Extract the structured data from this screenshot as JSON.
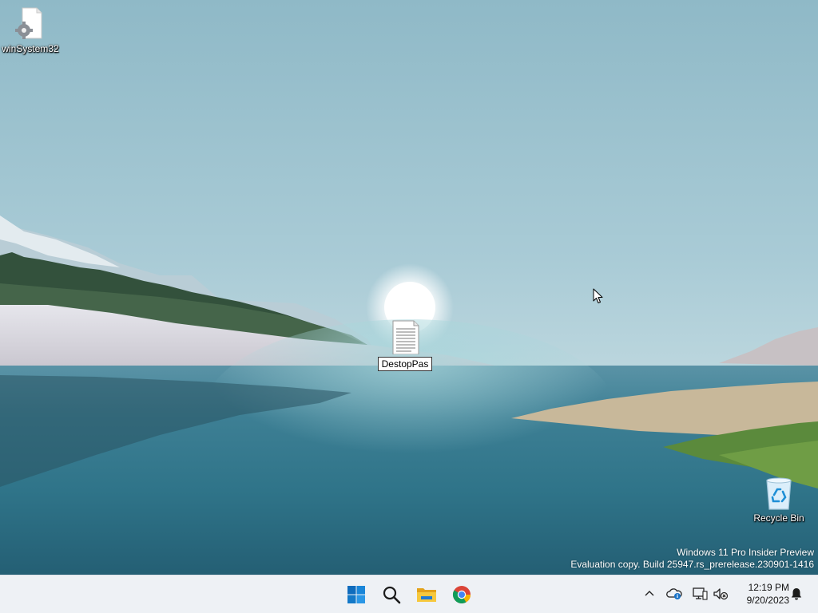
{
  "desktop": {
    "icons": [
      {
        "label": "winSystem32",
        "icon": "settings-file-icon"
      },
      {
        "label": "DestopPas",
        "icon": "text-document-icon"
      },
      {
        "label": "Recycle Bin",
        "icon": "recycle-bin-icon"
      }
    ]
  },
  "watermark": {
    "line1": "Windows 11 Pro Insider Preview",
    "line2": "Evaluation copy. Build 25947.rs_prerelease.230901-1416"
  },
  "taskbar": {
    "apps": [
      "start-icon",
      "search-icon",
      "file-explorer-icon",
      "chrome-icon"
    ],
    "tray": [
      "chevron-up-icon",
      "onedrive-icon",
      "network-icon",
      "volume-muted-icon",
      "notification-bell-icon"
    ],
    "time": "12:19 PM",
    "date": "9/20/2023"
  },
  "colors": {
    "taskbar_bg": "#eef1f5",
    "windows_blue": "#0078d4",
    "folder_yellow": "#f3c13a"
  }
}
